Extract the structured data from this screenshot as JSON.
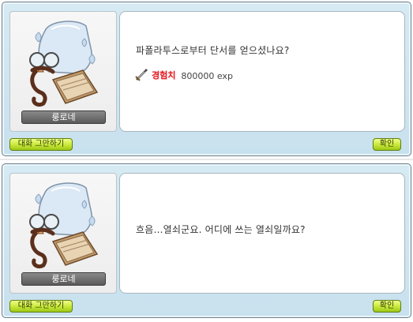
{
  "dialogs": [
    {
      "npc_name": "룽로네",
      "message": "파폴라투스로부터 단서를 얻으셨나요?",
      "reward": {
        "label": "경험치",
        "value": "800000 exp",
        "icon": "sword-icon"
      },
      "end_chat_label": "대화 그만하기",
      "ok_label": "확인"
    },
    {
      "npc_name": "룽로네",
      "message": "흐음…열쇠군요. 어디에 쓰는 열쇠일까요?",
      "end_chat_label": "대화 그만하기",
      "ok_label": "확인"
    }
  ],
  "colors": {
    "dialog_bg": "#c8e1ee",
    "button_green": "#c8e63a",
    "exp_red": "#e11b24",
    "name_plate": "#5a5a5a"
  }
}
